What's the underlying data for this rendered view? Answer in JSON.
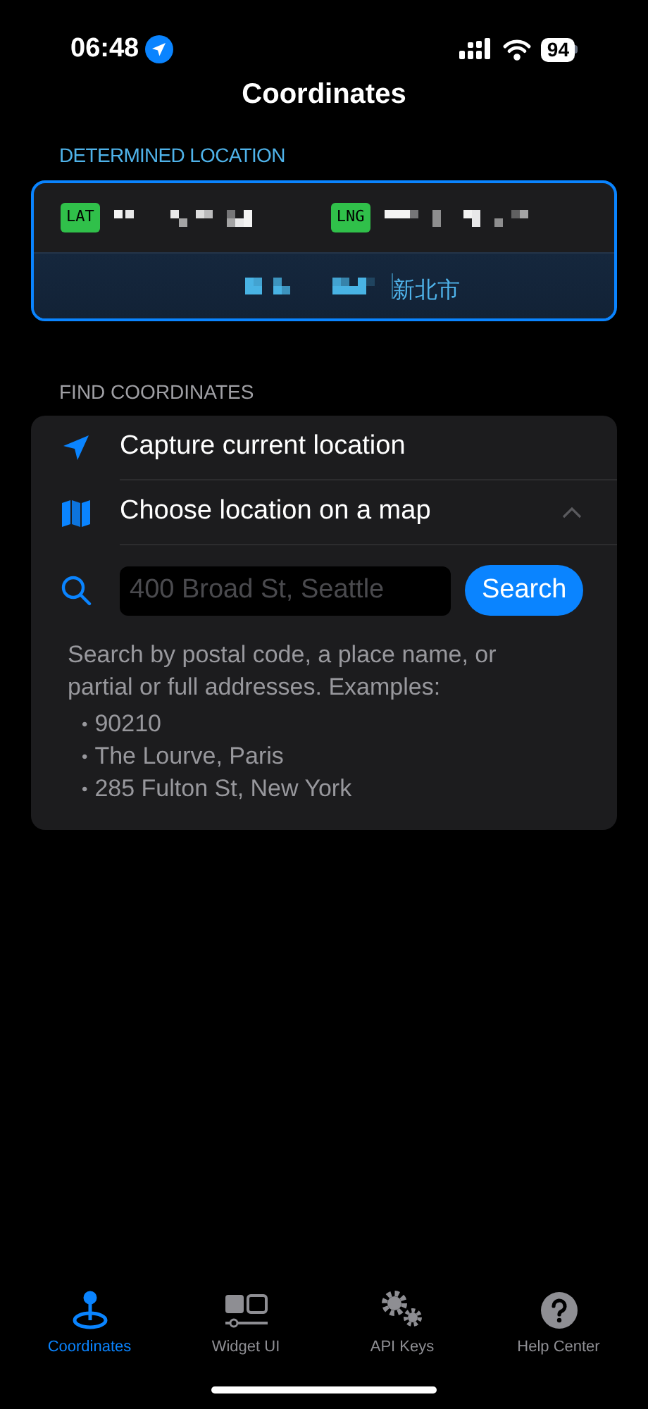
{
  "status_bar": {
    "time": "06:48",
    "battery": "94"
  },
  "title": "Coordinates",
  "determined": {
    "header": "DETERMINED LOCATION",
    "lat_badge": "LAT",
    "lng_badge": "LNG",
    "place_suffix": "新北市"
  },
  "find": {
    "header": "FIND COORDINATES",
    "options": [
      {
        "kind": "capture",
        "label": "Capture current location",
        "expanded": false
      },
      {
        "kind": "map",
        "label": "Choose location on a map",
        "expanded": true
      }
    ],
    "search": {
      "placeholder": "400 Broad St, Seattle",
      "button": "Search"
    },
    "help": "Search by postal code, a place name, or partial or full addresses. Examples:",
    "examples": [
      "90210",
      "The Lourve, Paris",
      "285 Fulton St, New York"
    ],
    "bullet": "•"
  },
  "tabs": [
    {
      "kind": "pin",
      "label": "Coordinates",
      "selected": true
    },
    {
      "kind": "widget",
      "label": "Widget UI",
      "selected": false
    },
    {
      "kind": "gears",
      "label": "API Keys",
      "selected": false
    },
    {
      "kind": "help",
      "label": "Help Center",
      "selected": false
    }
  ]
}
